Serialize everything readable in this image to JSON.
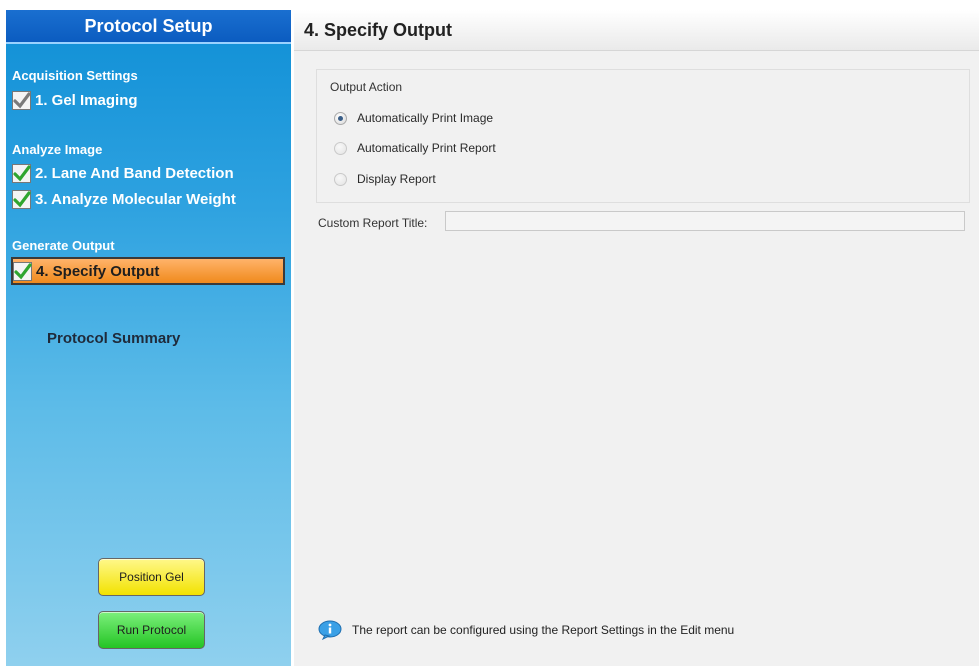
{
  "sidebar": {
    "title": "Protocol Setup",
    "sections": {
      "acquisition": "Acquisition Settings",
      "analyze": "Analyze Image",
      "generate": "Generate Output"
    },
    "steps": {
      "gel_imaging": "1. Gel Imaging",
      "lane_detection": "2. Lane And Band Detection",
      "molecular_weight": "3. Analyze Molecular Weight",
      "specify_output": "4. Specify Output"
    },
    "summary": "Protocol Summary",
    "buttons": {
      "position_gel": "Position Gel",
      "run_protocol": "Run Protocol"
    }
  },
  "main": {
    "title": "4. Specify Output",
    "output_action_label": "Output Action",
    "options": {
      "print_image": "Automatically Print Image",
      "print_report": "Automatically Print Report",
      "display_report": "Display Report"
    },
    "selected_option": "Automatically Print Image",
    "custom_report_title_label": "Custom Report Title:",
    "custom_report_title_value": "",
    "info_text": "The report can be configured using the Report Settings in the Edit menu"
  },
  "colors": {
    "sidebar_top": "#0f8fd6",
    "sidebar_bottom": "#8fd0ee",
    "selected_step": "#f08a1c",
    "check_green": "#2fa52f",
    "position_gel_button": "#f2e200",
    "run_protocol_button": "#24c424"
  },
  "icons": {
    "step_check": "check-icon",
    "info": "info-icon"
  }
}
